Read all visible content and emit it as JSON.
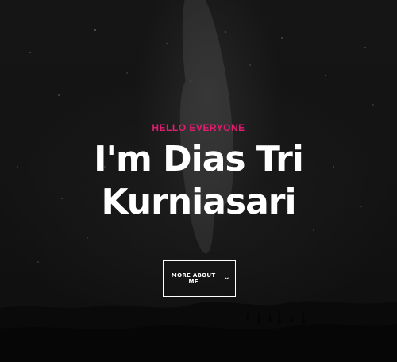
{
  "hero": {
    "kicker": "HELLO EVERYONE",
    "title_line_1": "I'm Dias Tri",
    "title_line_2": "Kurniasari",
    "cta_label": "MORE ABOUT ME",
    "cta_icon": "chevron-down-icon",
    "colors": {
      "accent": "#e01d6f",
      "text": "#ffffff",
      "background": "#0f0f0f"
    }
  }
}
